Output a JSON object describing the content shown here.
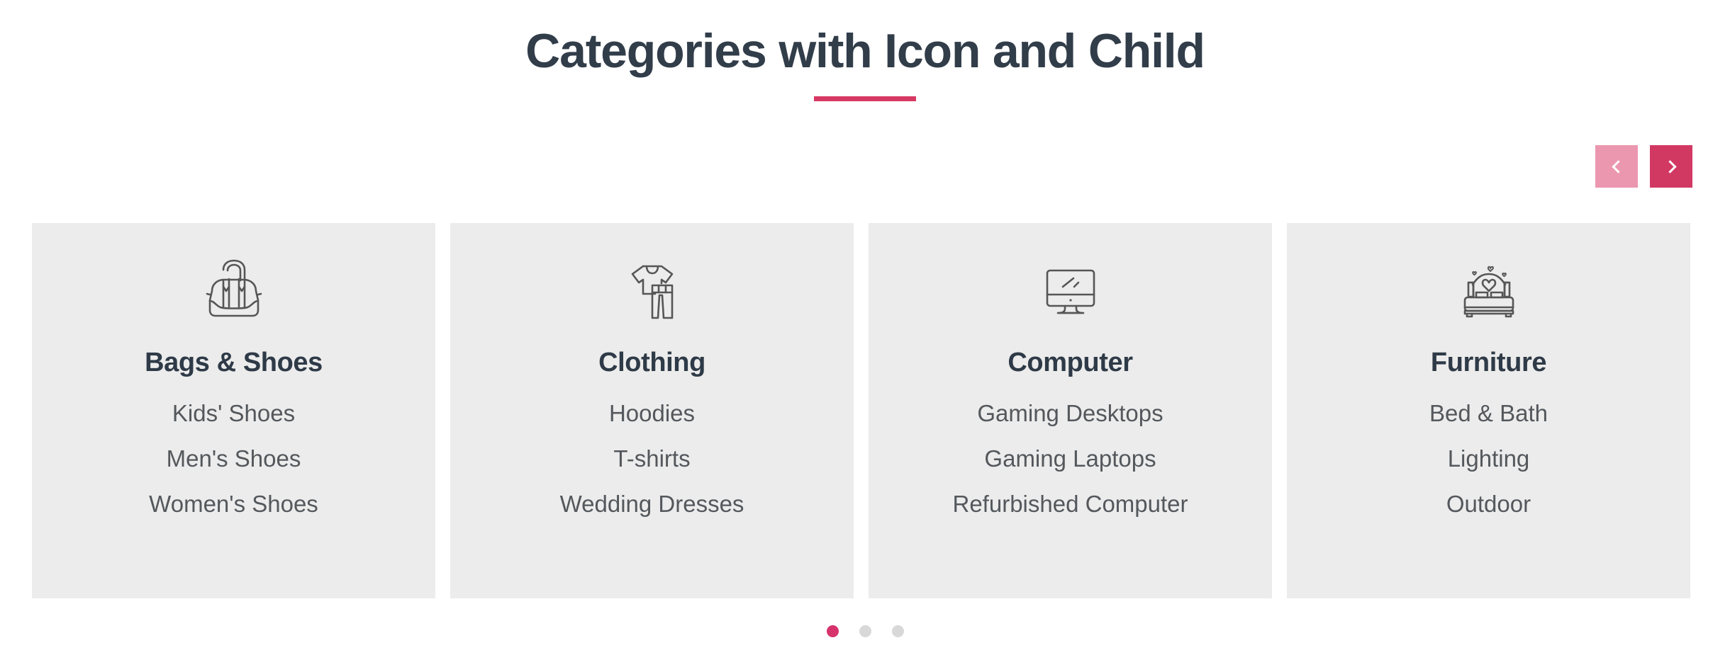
{
  "section": {
    "title": "Categories with Icon and Child",
    "title_color": "#323d4a",
    "underline_color": "#d63963"
  },
  "carousel": {
    "prev_label": "‹",
    "next_label": "›",
    "prev_icon": "chevron-left-icon",
    "next_icon": "chevron-right-icon",
    "prev_color": "#ec97b0",
    "next_color": "#d13963",
    "cards": [
      {
        "icon": "handbag-icon",
        "title": "Bags & Shoes",
        "children": [
          "Kids' Shoes",
          "Men's Shoes",
          "Women's Shoes"
        ]
      },
      {
        "icon": "clothing-icon",
        "title": "Clothing",
        "children": [
          "Hoodies",
          "T-shirts",
          "Wedding Dresses"
        ]
      },
      {
        "icon": "desktop-monitor-icon",
        "title": "Computer",
        "children": [
          "Gaming Desktops",
          "Gaming Laptops",
          "Refurbished Computer"
        ]
      },
      {
        "icon": "bed-icon",
        "title": "Furniture",
        "children": [
          "Bed & Bath",
          "Lighting",
          "Outdoor"
        ]
      }
    ],
    "pagination": {
      "count": 3,
      "active_index": 0,
      "active_color": "#d6336c",
      "inactive_color": "#d8d8d8"
    }
  }
}
